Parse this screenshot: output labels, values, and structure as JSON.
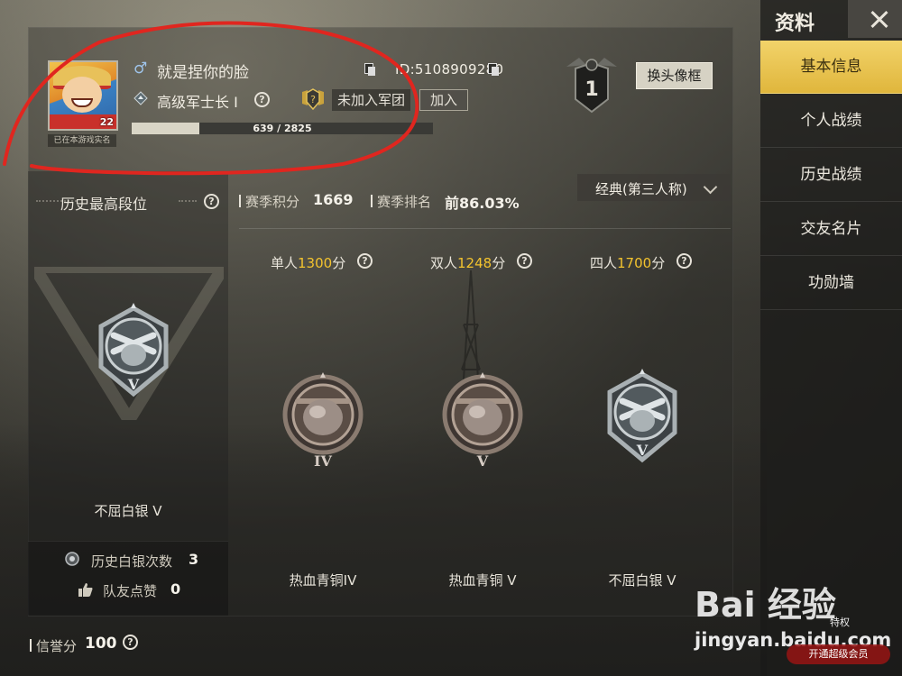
{
  "profile": {
    "name": "就是捏你的脸",
    "gender_symbol": "♂",
    "id_text": "ID:5108909280",
    "rank_title": "高级军士长 I",
    "clan_status": "未加入军团",
    "join_label": "加入",
    "xp_text": "639 / 2825",
    "xp_fraction": 0.226,
    "avatar_level": "22",
    "realname_label": "已在本游戏实名",
    "tier_number": "1",
    "avatar_frame_label": "换头像框"
  },
  "history": {
    "title": "历史最高段位",
    "tier_name": "不屈白银 V",
    "silver_count_label": "历史白银次数",
    "silver_count": "3",
    "likes_label": "队友点赞",
    "likes": "0"
  },
  "season": {
    "points_label": "赛季积分",
    "points": "1669",
    "rank_label": "赛季排名",
    "rank": "前86.03%",
    "mode": "经典(第三人称)"
  },
  "modes": [
    {
      "prefix": "单人",
      "score": "1300",
      "suffix": "分",
      "tier": "热血青铜IV",
      "medal": "bronze",
      "roman": "IV"
    },
    {
      "prefix": "双人",
      "score": "1248",
      "suffix": "分",
      "tier": "热血青铜 V",
      "medal": "bronze",
      "roman": "V"
    },
    {
      "prefix": "四人",
      "score": "1700",
      "suffix": "分",
      "tier": "不屈白银 V",
      "medal": "silver",
      "roman": "V"
    }
  ],
  "credit": {
    "label": "信誉分",
    "value": "100"
  },
  "nav": {
    "title": "资料",
    "items": [
      "基本信息",
      "个人战绩",
      "历史战绩",
      "交友名片",
      "功勋墙"
    ]
  },
  "watermark": {
    "logo": "Bai 经验",
    "url": "jingyan.baidu.com",
    "badge": "开通超级会员",
    "small": "特权"
  },
  "colors": {
    "accent": "#e0b63c",
    "score_yellow": "#f3c32e",
    "annotation_red": "#e0261f"
  }
}
